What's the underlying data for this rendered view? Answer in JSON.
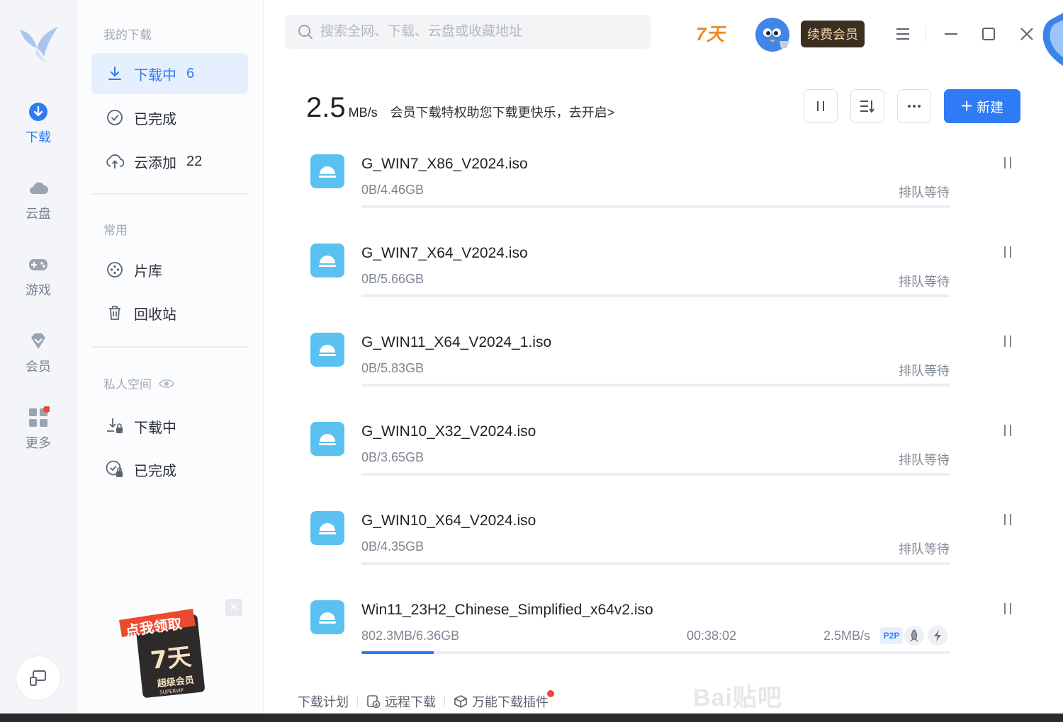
{
  "rail": {
    "items": [
      {
        "label": "下载",
        "icon": "download-icon"
      },
      {
        "label": "云盘",
        "icon": "cloud-icon"
      },
      {
        "label": "游戏",
        "icon": "gamepad-icon"
      },
      {
        "label": "会员",
        "icon": "diamond-icon"
      },
      {
        "label": "更多",
        "icon": "grid-icon"
      }
    ]
  },
  "nav": {
    "my_downloads_title": "我的下载",
    "downloading": {
      "label": "下载中",
      "count": "6"
    },
    "completed": {
      "label": "已完成"
    },
    "cloud_add": {
      "label": "云添加",
      "count": "22"
    },
    "common_title": "常用",
    "library": {
      "label": "片库"
    },
    "recycle": {
      "label": "回收站"
    },
    "private_title": "私人空间",
    "private_downloading": {
      "label": "下载中"
    },
    "private_completed": {
      "label": "已完成"
    },
    "promo": {
      "line1": "点我领取",
      "line2": "7天",
      "line3": "超级会员",
      "line4": "SUPERVIP"
    }
  },
  "topbar": {
    "search_placeholder": "搜索全网、下载、云盘或收藏地址",
    "days": "7天",
    "renew_label": "续费会员"
  },
  "toolbar": {
    "speed_value": "2.5",
    "speed_unit": "MB/s",
    "vip_tip": "会员下载特权助您下载更快乐，去开启>",
    "new_label": "新建"
  },
  "downloads": [
    {
      "name": "G_WIN7_X86_V2024.iso",
      "size": "0B/4.46GB",
      "status": "排队等待",
      "progress": 0
    },
    {
      "name": "G_WIN7_X64_V2024.iso",
      "size": "0B/5.66GB",
      "status": "排队等待",
      "progress": 0
    },
    {
      "name": "G_WIN11_X64_V2024_1.iso",
      "size": "0B/5.83GB",
      "status": "排队等待",
      "progress": 0
    },
    {
      "name": "G_WIN10_X32_V2024.iso",
      "size": "0B/3.65GB",
      "status": "排队等待",
      "progress": 0
    },
    {
      "name": "G_WIN10_X64_V2024.iso",
      "size": "0B/4.35GB",
      "status": "排队等待",
      "progress": 0
    },
    {
      "name": "Win11_23H2_Chinese_Simplified_x64v2.iso",
      "size": "802.3MB/6.36GB",
      "eta": "00:38:02",
      "rate": "2.5MB/s",
      "badge": "P2P",
      "progress": 0.123
    }
  ],
  "footer": {
    "plan": "下载计划",
    "remote": "远程下载",
    "plugin": "万能下载插件"
  },
  "watermark": "Bai贴吧",
  "colors": {
    "accent": "#2f7bf5",
    "file_icon": "#5bc1f0",
    "renew_bg": "#3b2f22",
    "days": "#f08a2a"
  }
}
